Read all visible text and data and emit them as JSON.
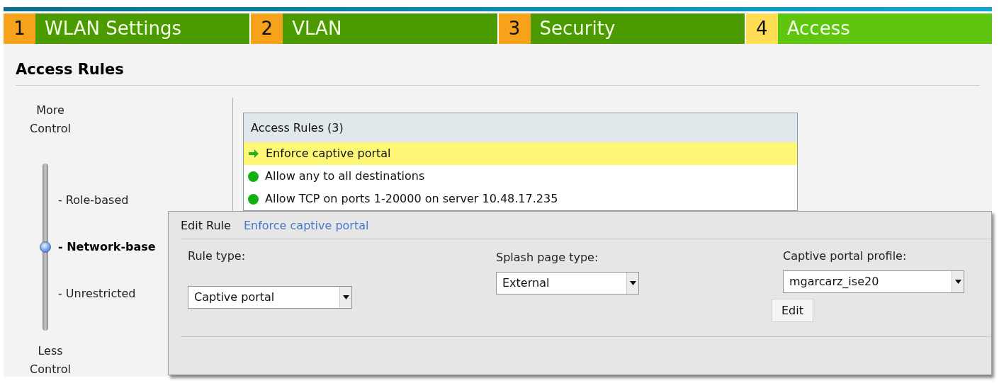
{
  "steps": [
    {
      "number": "1",
      "label": "WLAN Settings",
      "selected": false
    },
    {
      "number": "2",
      "label": "VLAN",
      "selected": false
    },
    {
      "number": "3",
      "label": "Security",
      "selected": false
    },
    {
      "number": "4",
      "label": "Access",
      "selected": true
    }
  ],
  "section_title": "Access Rules",
  "control_scale": {
    "top_label": "More Control",
    "bottom_label": "Less Control",
    "options": [
      {
        "label": "- Role-based",
        "selected": false
      },
      {
        "label": "- Network-base",
        "selected": true
      },
      {
        "label": "- Unrestricted",
        "selected": false
      }
    ]
  },
  "rules_list": {
    "header": "Access Rules (3)",
    "rules": [
      {
        "label": "Enforce captive portal",
        "selected": true
      },
      {
        "label": "Allow any to all destinations",
        "selected": false
      },
      {
        "label": "Allow TCP on ports 1-20000 on server 10.48.17.235",
        "selected": false
      }
    ]
  },
  "edit_rule": {
    "title": "Edit Rule",
    "rule_name": "Enforce captive portal",
    "fields": [
      {
        "label": "Rule type:",
        "value": "Captive portal"
      },
      {
        "label": "Splash page type:",
        "value": "External"
      },
      {
        "label": "Captive portal profile:",
        "value": "mgarcarz_ise20",
        "button": "Edit"
      }
    ]
  }
}
